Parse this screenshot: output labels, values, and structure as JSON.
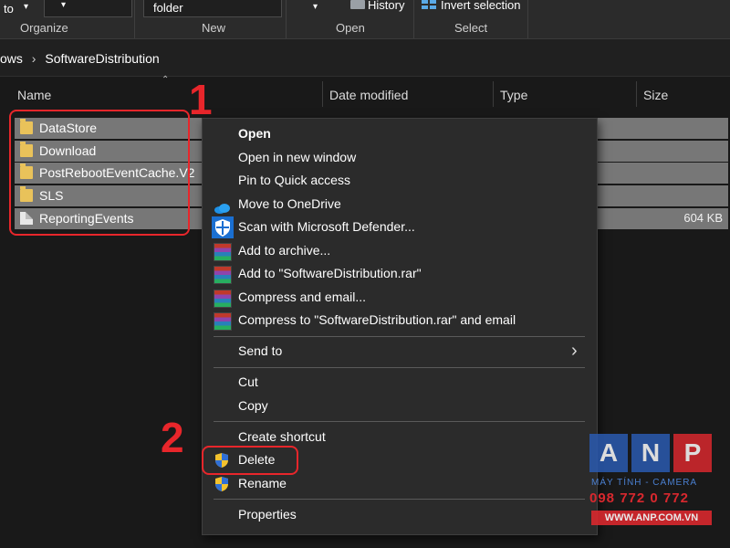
{
  "ribbon": {
    "to_label": "to",
    "folder_label": "folder",
    "history_label": "History",
    "invert_selection_label": "Invert selection",
    "groups": [
      "Organize",
      "New",
      "Open",
      "Select"
    ]
  },
  "address": {
    "path": [
      "ows",
      "SoftwareDistribution"
    ]
  },
  "columns": {
    "name": "Name",
    "date_modified": "Date modified",
    "type": "Type",
    "size": "Size"
  },
  "files": [
    {
      "name": "DataStore",
      "kind": "folder",
      "size": ""
    },
    {
      "name": "Download",
      "kind": "folder",
      "size": ""
    },
    {
      "name": "PostRebootEventCache.V2",
      "kind": "folder",
      "size": ""
    },
    {
      "name": "SLS",
      "kind": "folder",
      "size": ""
    },
    {
      "name": "ReportingEvents",
      "kind": "file",
      "size": "604 KB"
    }
  ],
  "context_menu": {
    "items": [
      {
        "label": "Open",
        "icon": "none"
      },
      {
        "label": "Open in new window",
        "icon": "none"
      },
      {
        "label": "Pin to Quick access",
        "icon": "none"
      },
      {
        "label": "Move to OneDrive",
        "icon": "onedrive-cloud-icon"
      },
      {
        "label": "Scan with Microsoft Defender...",
        "icon": "defender-shield-icon"
      },
      {
        "label": "Add to archive...",
        "icon": "winrar-icon"
      },
      {
        "label": "Add to \"SoftwareDistribution.rar\"",
        "icon": "winrar-icon"
      },
      {
        "label": "Compress and email...",
        "icon": "winrar-icon"
      },
      {
        "label": "Compress to \"SoftwareDistribution.rar\" and email",
        "icon": "winrar-icon"
      },
      {
        "label": "Send to",
        "icon": "chevron-right-icon"
      },
      {
        "label": "Cut",
        "icon": "none"
      },
      {
        "label": "Copy",
        "icon": "none"
      },
      {
        "label": "Create shortcut",
        "icon": "none"
      },
      {
        "label": "Delete",
        "icon": "uac-shield-icon"
      },
      {
        "label": "Rename",
        "icon": "uac-shield-icon"
      },
      {
        "label": "Properties",
        "icon": "none"
      }
    ]
  },
  "annotations": {
    "step1": "1",
    "step2": "2"
  },
  "watermark": {
    "letters": [
      "A",
      "N",
      "P"
    ],
    "tagline": "MÁY TÍNH - CAMERA",
    "phone": "098 772 0 772",
    "website": "WWW.ANP.COM.VN"
  },
  "colors": {
    "background": "#191919",
    "selection": "#777777",
    "menu": "#2b2b2b",
    "annotation_red": "#e8262b",
    "folder_yellow": "#e9c25a"
  }
}
